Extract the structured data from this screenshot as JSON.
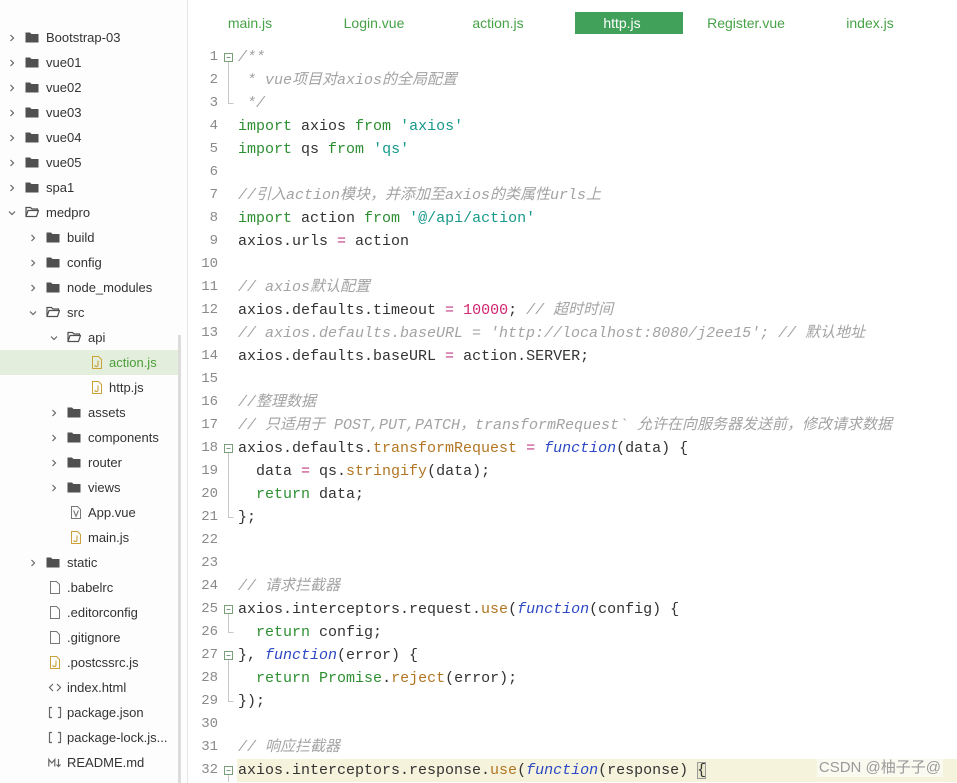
{
  "tabs": [
    {
      "label": "main.js",
      "active": false
    },
    {
      "label": "Login.vue",
      "active": false
    },
    {
      "label": "action.js",
      "active": false
    },
    {
      "label": "http.js",
      "active": true
    },
    {
      "label": "Register.vue",
      "active": false
    },
    {
      "label": "index.js",
      "active": false
    }
  ],
  "tree": [
    {
      "label": "Bootstrap-03",
      "icon": "folder",
      "expanded": false
    },
    {
      "label": "vue01",
      "icon": "folder",
      "expanded": false
    },
    {
      "label": "vue02",
      "icon": "folder",
      "expanded": false
    },
    {
      "label": "vue03",
      "icon": "folder",
      "expanded": false
    },
    {
      "label": "vue04",
      "icon": "folder",
      "expanded": false
    },
    {
      "label": "vue05",
      "icon": "folder",
      "expanded": false
    },
    {
      "label": "spa1",
      "icon": "folder",
      "expanded": false
    },
    {
      "label": "medpro",
      "icon": "folder-open",
      "expanded": true,
      "children": [
        {
          "label": "build",
          "icon": "folder",
          "expanded": false
        },
        {
          "label": "config",
          "icon": "folder",
          "expanded": false
        },
        {
          "label": "node_modules",
          "icon": "folder",
          "expanded": false
        },
        {
          "label": "src",
          "icon": "folder-open",
          "expanded": true,
          "children": [
            {
              "label": "api",
              "icon": "folder-open",
              "expanded": true,
              "children": [
                {
                  "label": "action.js",
                  "icon": "js",
                  "selected": true
                },
                {
                  "label": "http.js",
                  "icon": "js"
                }
              ]
            },
            {
              "label": "assets",
              "icon": "folder",
              "expanded": false
            },
            {
              "label": "components",
              "icon": "folder",
              "expanded": false
            },
            {
              "label": "router",
              "icon": "folder",
              "expanded": false
            },
            {
              "label": "views",
              "icon": "folder",
              "expanded": false
            },
            {
              "label": "App.vue",
              "icon": "vue"
            },
            {
              "label": "main.js",
              "icon": "js"
            }
          ]
        },
        {
          "label": "static",
          "icon": "folder",
          "expanded": false
        },
        {
          "label": ".babelrc",
          "icon": "file"
        },
        {
          "label": ".editorconfig",
          "icon": "file"
        },
        {
          "label": ".gitignore",
          "icon": "file"
        },
        {
          "label": ".postcssrc.js",
          "icon": "js"
        },
        {
          "label": "index.html",
          "icon": "html"
        },
        {
          "label": "package.json",
          "icon": "json"
        },
        {
          "label": "package-lock.js...",
          "icon": "json"
        },
        {
          "label": "README.md",
          "icon": "md"
        }
      ]
    }
  ],
  "editor": {
    "current_line": 32,
    "lines": [
      {
        "n": 1,
        "fold": "start",
        "tokens": [
          [
            "cm",
            "/**"
          ]
        ]
      },
      {
        "n": 2,
        "fold": "mid",
        "tokens": [
          [
            "cm",
            " * vue项目对axios的全局配置"
          ]
        ]
      },
      {
        "n": 3,
        "fold": "end",
        "tokens": [
          [
            "cm",
            " */"
          ]
        ]
      },
      {
        "n": 4,
        "tokens": [
          [
            "kw",
            "import"
          ],
          [
            "pl",
            " axios "
          ],
          [
            "kw",
            "from"
          ],
          [
            "pl",
            " "
          ],
          [
            "str",
            "'axios'"
          ]
        ]
      },
      {
        "n": 5,
        "tokens": [
          [
            "kw",
            "import"
          ],
          [
            "pl",
            " qs "
          ],
          [
            "kw",
            "from"
          ],
          [
            "pl",
            " "
          ],
          [
            "str",
            "'qs'"
          ]
        ]
      },
      {
        "n": 6,
        "tokens": []
      },
      {
        "n": 7,
        "tokens": [
          [
            "cm",
            "//引入action模块，并添加至axios的类属性urls上"
          ]
        ]
      },
      {
        "n": 8,
        "tokens": [
          [
            "kw",
            "import"
          ],
          [
            "pl",
            " action "
          ],
          [
            "kw",
            "from"
          ],
          [
            "pl",
            " "
          ],
          [
            "str",
            "'@/api/action'"
          ]
        ]
      },
      {
        "n": 9,
        "tokens": [
          [
            "pl",
            "axios.urls "
          ],
          [
            "op",
            "="
          ],
          [
            "pl",
            " action"
          ]
        ]
      },
      {
        "n": 10,
        "tokens": []
      },
      {
        "n": 11,
        "tokens": [
          [
            "cm",
            "// axios默认配置"
          ]
        ]
      },
      {
        "n": 12,
        "tokens": [
          [
            "pl",
            "axios.defaults.timeout "
          ],
          [
            "op",
            "="
          ],
          [
            "pl",
            " "
          ],
          [
            "num",
            "10000"
          ],
          [
            "pl",
            "; "
          ],
          [
            "cm",
            "// 超时时间"
          ]
        ]
      },
      {
        "n": 13,
        "tokens": [
          [
            "cm",
            "// axios.defaults.baseURL = 'http://localhost:8080/j2ee15'; // 默认地址"
          ]
        ]
      },
      {
        "n": 14,
        "tokens": [
          [
            "pl",
            "axios.defaults.baseURL "
          ],
          [
            "op",
            "="
          ],
          [
            "pl",
            " action.SERVER;"
          ]
        ]
      },
      {
        "n": 15,
        "tokens": []
      },
      {
        "n": 16,
        "tokens": [
          [
            "cm",
            "//整理数据"
          ]
        ]
      },
      {
        "n": 17,
        "tokens": [
          [
            "cm",
            "// 只适用于 POST,PUT,PATCH，transformRequest` 允许在向服务器发送前，修改请求数据"
          ]
        ]
      },
      {
        "n": 18,
        "fold": "start",
        "tokens": [
          [
            "pl",
            "axios.defaults."
          ],
          [
            "me",
            "transformRequest"
          ],
          [
            "pl",
            " "
          ],
          [
            "op",
            "="
          ],
          [
            "pl",
            " "
          ],
          [
            "fn",
            "function"
          ],
          [
            "pl",
            "(data) {"
          ]
        ]
      },
      {
        "n": 19,
        "fold": "mid",
        "tokens": [
          [
            "pl",
            "  data "
          ],
          [
            "op",
            "="
          ],
          [
            "pl",
            " qs."
          ],
          [
            "me",
            "stringify"
          ],
          [
            "pl",
            "(data);"
          ]
        ]
      },
      {
        "n": 20,
        "fold": "mid",
        "tokens": [
          [
            "pl",
            "  "
          ],
          [
            "kw",
            "return"
          ],
          [
            "pl",
            " data;"
          ]
        ]
      },
      {
        "n": 21,
        "fold": "end",
        "tokens": [
          [
            "pl",
            "};"
          ]
        ]
      },
      {
        "n": 22,
        "tokens": []
      },
      {
        "n": 23,
        "tokens": []
      },
      {
        "n": 24,
        "tokens": [
          [
            "cm",
            "// 请求拦截器"
          ]
        ]
      },
      {
        "n": 25,
        "fold": "start",
        "tokens": [
          [
            "pl",
            "axios.interceptors.request."
          ],
          [
            "me",
            "use"
          ],
          [
            "pl",
            "("
          ],
          [
            "fn",
            "function"
          ],
          [
            "pl",
            "(config) {"
          ]
        ]
      },
      {
        "n": 26,
        "fold": "end",
        "tokens": [
          [
            "pl",
            "  "
          ],
          [
            "kw",
            "return"
          ],
          [
            "pl",
            " config;"
          ]
        ]
      },
      {
        "n": 27,
        "fold": "start",
        "tokens": [
          [
            "pl",
            "}, "
          ],
          [
            "fn",
            "function"
          ],
          [
            "pl",
            "(error) {"
          ]
        ]
      },
      {
        "n": 28,
        "fold": "mid",
        "tokens": [
          [
            "pl",
            "  "
          ],
          [
            "kw",
            "return"
          ],
          [
            "pl",
            " "
          ],
          [
            "ty",
            "Promise"
          ],
          [
            "pl",
            "."
          ],
          [
            "me",
            "reject"
          ],
          [
            "pl",
            "(error);"
          ]
        ]
      },
      {
        "n": 29,
        "fold": "end",
        "tokens": [
          [
            "pl",
            "});"
          ]
        ]
      },
      {
        "n": 30,
        "tokens": []
      },
      {
        "n": 31,
        "tokens": [
          [
            "cm",
            "// 响应拦截器"
          ]
        ]
      },
      {
        "n": 32,
        "fold": "start",
        "tokens": [
          [
            "pl",
            "axios.interceptors.response."
          ],
          [
            "me",
            "use"
          ],
          [
            "pl",
            "("
          ],
          [
            "fn",
            "function"
          ],
          [
            "pl",
            "(response) "
          ],
          [
            "brace",
            "{"
          ]
        ]
      }
    ]
  },
  "watermark": "CSDN @柚子子@",
  "colors": {
    "accent": "#41a05a",
    "tab_text": "#47a247",
    "selected_text": "#4c9e3a",
    "selected_row": "#e3efdc",
    "keyword": "#2d8f32",
    "string": "#18998a",
    "comment": "#a3a3a3",
    "number": "#d0256f",
    "operator": "#c13b85",
    "function_keyword": "#2c48c4",
    "method": "#b27623",
    "type": "#2d8f32",
    "current_line": "#f5f3dc",
    "plain": "#333333"
  }
}
